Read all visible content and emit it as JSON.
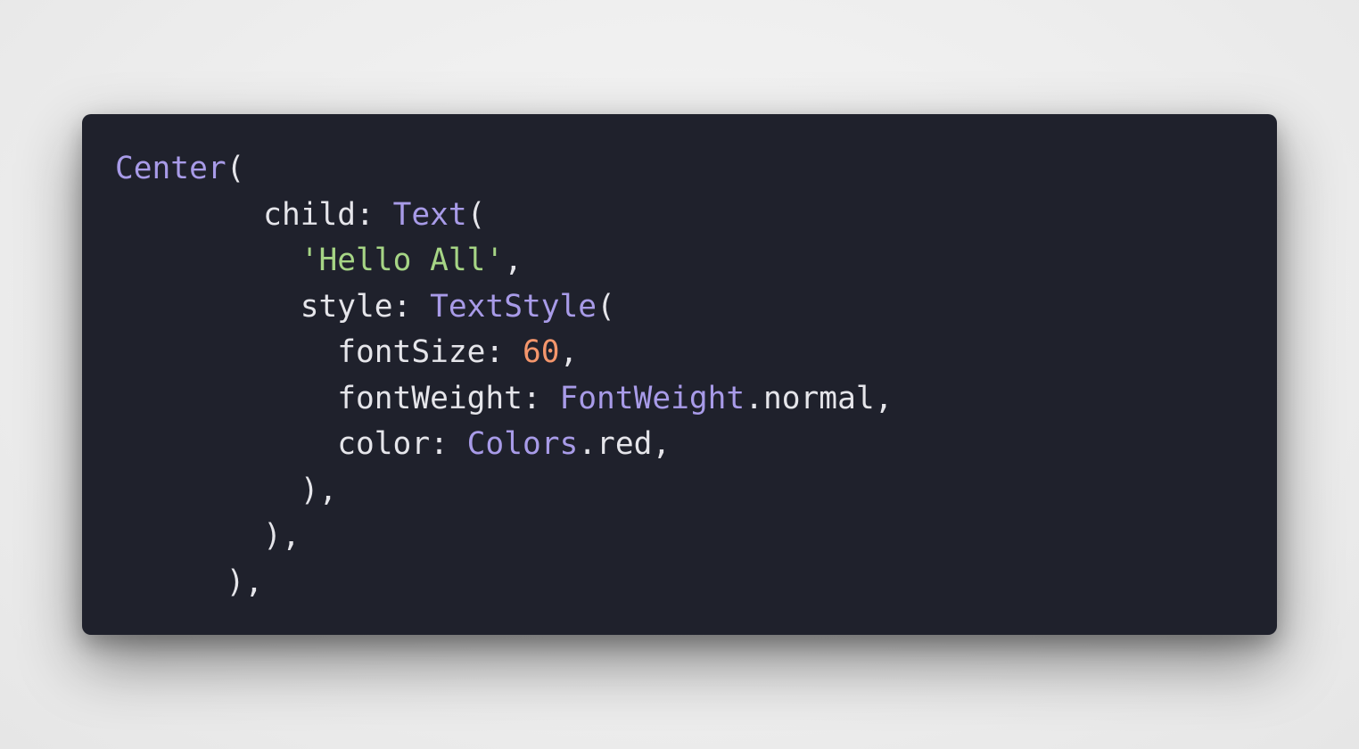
{
  "colors": {
    "background": "#eeeeee",
    "panel": "#1f212c",
    "plain_text": "#e5e5ea",
    "class_name": "#a89be8",
    "string": "#a6d585",
    "number": "#f4966c"
  },
  "code_lines": [
    {
      "indent": "",
      "tokens": [
        {
          "type": "class",
          "text": "Center"
        },
        {
          "type": "plain",
          "text": "("
        }
      ]
    },
    {
      "indent": "        ",
      "tokens": [
        {
          "type": "plain",
          "text": "child: "
        },
        {
          "type": "class",
          "text": "Text"
        },
        {
          "type": "plain",
          "text": "("
        }
      ]
    },
    {
      "indent": "          ",
      "tokens": [
        {
          "type": "string",
          "text": "'Hello All'"
        },
        {
          "type": "plain",
          "text": ","
        }
      ]
    },
    {
      "indent": "          ",
      "tokens": [
        {
          "type": "plain",
          "text": "style: "
        },
        {
          "type": "class",
          "text": "TextStyle"
        },
        {
          "type": "plain",
          "text": "("
        }
      ]
    },
    {
      "indent": "            ",
      "tokens": [
        {
          "type": "plain",
          "text": "fontSize: "
        },
        {
          "type": "number",
          "text": "60"
        },
        {
          "type": "plain",
          "text": ","
        }
      ]
    },
    {
      "indent": "            ",
      "tokens": [
        {
          "type": "plain",
          "text": "fontWeight: "
        },
        {
          "type": "class",
          "text": "FontWeight"
        },
        {
          "type": "plain",
          "text": ".normal,"
        }
      ]
    },
    {
      "indent": "            ",
      "tokens": [
        {
          "type": "plain",
          "text": "color: "
        },
        {
          "type": "class",
          "text": "Colors"
        },
        {
          "type": "plain",
          "text": ".red,"
        }
      ]
    },
    {
      "indent": "          ",
      "tokens": [
        {
          "type": "plain",
          "text": "),"
        }
      ]
    },
    {
      "indent": "        ",
      "tokens": [
        {
          "type": "plain",
          "text": "),"
        }
      ]
    },
    {
      "indent": "      ",
      "tokens": [
        {
          "type": "plain",
          "text": "),"
        }
      ]
    }
  ]
}
